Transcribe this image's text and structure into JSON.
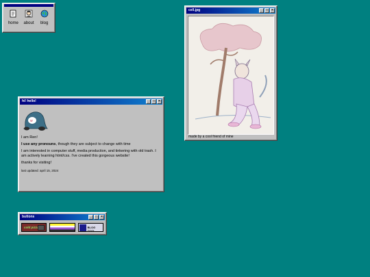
{
  "nav": {
    "title": "",
    "items": [
      {
        "label": "home",
        "icon": "document-icon"
      },
      {
        "label": "about",
        "icon": "person-icon"
      },
      {
        "label": "blog",
        "icon": "globe-icon"
      }
    ]
  },
  "photo_window": {
    "title": "cell.jpg",
    "caption": "made by a cool friend of mine"
  },
  "hello_window": {
    "title": "hi! hello!",
    "greeting": "I am Ren!",
    "pronouns_bold": "I use any pronouns",
    "pronouns_rest": ", though they are subject to change with time",
    "interests": "I am interested in computer stuff, media production, and tinkering with old trash. I am actively learning html/css. I've created this gorgeous website!",
    "thanks": "thanks for visiting!",
    "updated": "last updated: april 15, 2024"
  },
  "buttons_window": {
    "title": "buttons",
    "badges": [
      {
        "name": "badge-1",
        "text": "cold pizza"
      },
      {
        "name": "badge-2",
        "text": ""
      },
      {
        "name": "badge-3",
        "text": "BLOG TOOL"
      }
    ]
  },
  "colors": {
    "desktop": "#008080",
    "titlebar_start": "#000080",
    "titlebar_end": "#1084d0",
    "window": "#c0c0c0"
  }
}
